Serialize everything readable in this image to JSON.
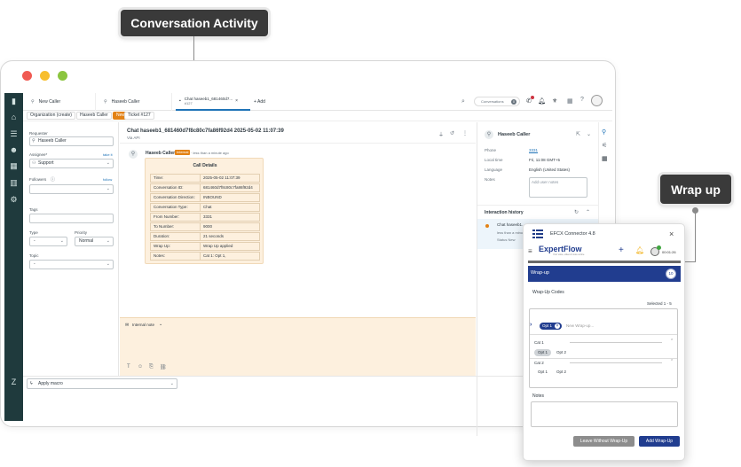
{
  "callouts": {
    "conversation_activity": "Conversation Activity",
    "wrap_up": "Wrap up"
  },
  "tabs": [
    {
      "label": "New Caller"
    },
    {
      "label": "Haseeb Caller"
    },
    {
      "label": "Chat haseeb1_681460d7...",
      "sub": "#127"
    },
    {
      "label": "+ Add"
    }
  ],
  "header": {
    "conversations_label": "Conversations",
    "conversations_count": "0"
  },
  "breadcrumbs": [
    "Organization (create)",
    "Haseeb Caller",
    "New",
    "Ticket #127"
  ],
  "left_form": {
    "requester_label": "Requester",
    "requester_value": "Haseeb Caller",
    "assignee_label": "Assignee*",
    "take_it": "take it",
    "assignee_value": "Support",
    "followers_label": "Followers",
    "follow": "follow",
    "tags_label": "Tags",
    "type_label": "Type",
    "type_value": "-",
    "priority_label": "Priority",
    "priority_value": "Normal",
    "topic_label": "Topic",
    "topic_value": "-"
  },
  "conversation": {
    "title": "Chat haseeb1_681460d7f8c80c7fa86f92d4 2025-05-02 11:07:39",
    "via": "Via API",
    "author": "Haseeb Caller",
    "badge": "Internal",
    "time": "· less than a minute ago",
    "table_title": "Call Details",
    "rows": [
      {
        "k": "Time:",
        "v": "2025-05-02 11:07:39"
      },
      {
        "k": "Conversation ID:",
        "v": "681460d7f8c80c7fa86f92d4"
      },
      {
        "k": "Conversation Direction:",
        "v": "INBOUND"
      },
      {
        "k": "Conversation Type:",
        "v": "Chat"
      },
      {
        "k": "From Number:",
        "v": "3331"
      },
      {
        "k": "To Number:",
        "v": "9000"
      },
      {
        "k": "Duration:",
        "v": "21 seconds"
      },
      {
        "k": "Wrap Up:",
        "v": "Wrap Up applied"
      },
      {
        "k": "Notes:",
        "v": "Cat 1: Opt 1,"
      }
    ],
    "note_label": "Internal note"
  },
  "bottom": {
    "apply_macro": "Apply macro"
  },
  "right_panel": {
    "name": "Haseeb Caller",
    "phone_label": "Phone",
    "phone_value": "3331",
    "local_time_label": "Local time",
    "local_time_value": "Fri, 11:08 GMT+5",
    "language_label": "Language",
    "language_value": "English (United States)",
    "notes_label": "Notes",
    "notes_placeholder": "Add user notes",
    "history_title": "Interaction history",
    "history_item_title": "Chat haseeb1...",
    "history_item_time": "less than a minute...",
    "history_item_status": "Status New"
  },
  "connector": {
    "title": "EFCX Connector 4.8",
    "brand": "ExpertFlow",
    "brand_tagline": "Your voice, video & more centre",
    "timer": "00:01:26",
    "wrap_header": "Wrap-up",
    "wrap_timer": "10",
    "codes_label": "Wrap-Up Codes",
    "selected": "Selected 1 - 5",
    "selected_chip": "Opt 1",
    "search_placeholder": "New Wrap-up...",
    "cat1": "Cat 1",
    "cat1_opts": [
      "Opt 1",
      "Opt 2"
    ],
    "cat2": "Cat 2",
    "cat2_opts": [
      "Opt 1",
      "Opt 2"
    ],
    "notes_label": "Notes",
    "leave_button": "Leave Without Wrap-Up",
    "add_button": "Add Wrap-Up"
  },
  "colors": {
    "rail": "#1f3a3d",
    "accent": "#1f73b7",
    "note_bg": "#fdf0de",
    "connector_blue": "#213d8f"
  }
}
